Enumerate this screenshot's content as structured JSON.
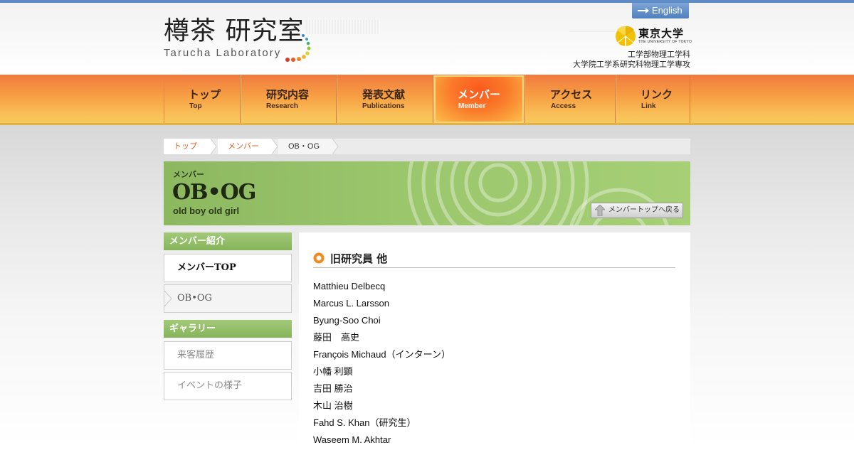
{
  "header": {
    "logo_jp": "樽茶 研究室",
    "logo_en": "Tarucha Laboratory",
    "english_label": "English",
    "university_jp": "東京大学",
    "university_en": "THE UNIVERSITY OF TOKYO",
    "dept_line1": "工学部物理工学科",
    "dept_line2": "大学院工学系研究科物理工学専攻",
    "colors": {
      "top_bar": "#5d8cc7",
      "nav_orange": "#f7a144",
      "accent_green": "#8cb860"
    }
  },
  "nav": {
    "items": [
      {
        "jp": "トップ",
        "en": "Top"
      },
      {
        "jp": "研究内容",
        "en": "Research"
      },
      {
        "jp": "発表文献",
        "en": "Publications"
      },
      {
        "jp": "メンバー",
        "en": "Member"
      },
      {
        "jp": "アクセス",
        "en": "Access"
      },
      {
        "jp": "リンク",
        "en": "Link"
      }
    ],
    "active": "メンバー"
  },
  "breadcrumb": {
    "items": [
      "トップ",
      "メンバー",
      "OB・OG"
    ]
  },
  "banner": {
    "subtitle": "メンバー",
    "title": "OB•OG",
    "english": "old boy old girl",
    "back_label": "メンバートップへ戻る"
  },
  "sidebar": {
    "members_heading": "メンバー紹介",
    "members_items": [
      "メンバーTOP",
      "OB•OG"
    ],
    "gallery_heading": "ギャラリー",
    "gallery_items": [
      "来客履歴",
      "イベントの様子"
    ]
  },
  "main": {
    "section_title": "旧研究員 他",
    "members": [
      "Matthieu Delbecq",
      "Marcus L. Larsson",
      "Byung-Soo Choi",
      "藤田　高史",
      "François Michaud（インターン）",
      "小幡 利顕",
      "吉田 勝治",
      "木山 治樹",
      "Fahd S. Khan（研究生）",
      "Waseem M. Akhtar"
    ]
  }
}
